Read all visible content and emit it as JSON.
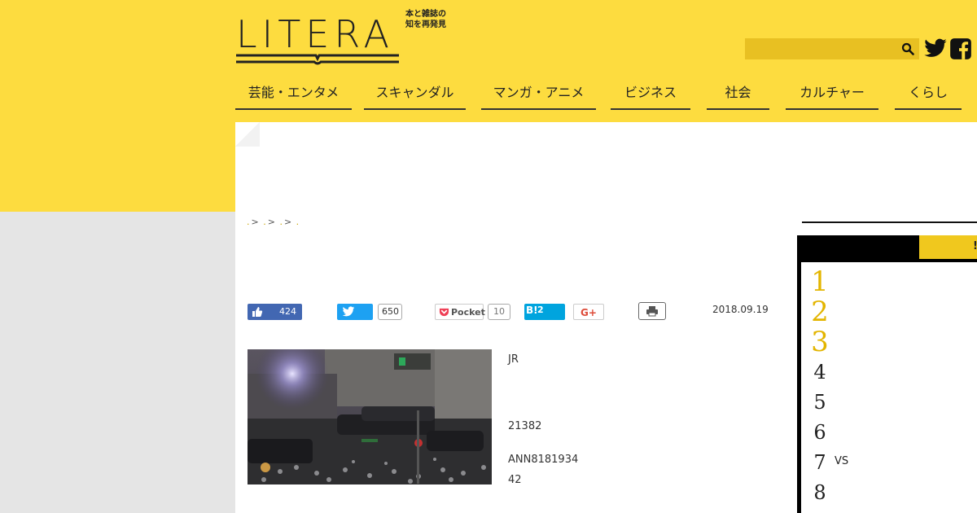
{
  "brand": {
    "logo_text": "LITERA",
    "tagline_line1": "本と雑誌の",
    "tagline_line2": "知を再発見",
    "color_accent": "#fddc3f"
  },
  "search": {
    "placeholder": "",
    "icon": "search-icon"
  },
  "social": {
    "twitter_icon": "twitter-icon",
    "facebook_icon": "facebook-icon"
  },
  "nav": {
    "items": [
      {
        "label": "芸能・エンタメ"
      },
      {
        "label": "スキャンダル"
      },
      {
        "label": "マンガ・アニメ"
      },
      {
        "label": "ビジネス"
      },
      {
        "label": "社会"
      },
      {
        "label": "カルチャー"
      },
      {
        "label": "くらし"
      }
    ]
  },
  "breadcrumb": {
    "sep": ">"
  },
  "share": {
    "fb_like_count": "424",
    "twitter_count": "650",
    "pocket_label": "Pocket",
    "pocket_count": "10",
    "hatena_label": "B!",
    "hatena_count": "2",
    "gplus_label": "G+"
  },
  "article": {
    "date": "2018.09.19",
    "lines": [
      "JR",
      "21382",
      "ANN8181934",
      "42"
    ]
  },
  "sidebar": {
    "tab_label": "!",
    "ranking": [
      {
        "rank": "1",
        "title": ""
      },
      {
        "rank": "2",
        "title": ""
      },
      {
        "rank": "3",
        "title": ""
      },
      {
        "rank": "4",
        "title": ""
      },
      {
        "rank": "5",
        "title": ""
      },
      {
        "rank": "6",
        "title": ""
      },
      {
        "rank": "7",
        "title": "VS"
      },
      {
        "rank": "8",
        "title": ""
      }
    ]
  }
}
